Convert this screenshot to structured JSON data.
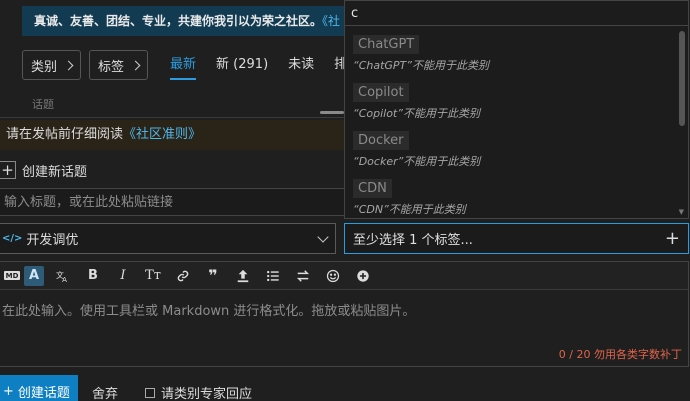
{
  "banner": {
    "text": "真诚、友善、团结、专业，共建你我引以为荣之社区。",
    "link": "《社"
  },
  "nav": {
    "category_label": "类别",
    "tags_label": "标签",
    "tabs": [
      {
        "label": "最新",
        "active": true
      },
      {
        "label": "新 (291)",
        "active": false
      },
      {
        "label": "未读",
        "active": false
      },
      {
        "label": "排",
        "active": false
      }
    ],
    "topic_column": "话题"
  },
  "composer": {
    "guideline_text": "请在发帖前仔细阅读",
    "guideline_link": "《社区准则》",
    "create_topic_label": "创建新话题",
    "title_placeholder": "输入标题，或在此处粘贴链接",
    "category_value": "开发调优",
    "tag_placeholder": "至少选择 1 个标签...",
    "editor_placeholder": "在此处输入。使用工具栏或 Markdown 进行格式化。拖放或粘贴图片。",
    "char_count": "0 / 20 勿用各类字数补丁",
    "submit_label": "创建话题",
    "discard_label": "舍弃",
    "expert_label": "请类别专家回应"
  },
  "toolbar": {
    "icons": [
      "markdown-toggle-icon",
      "font-style-icon",
      "translate-icon",
      "bold-icon",
      "italic-icon",
      "heading-icon",
      "link-icon",
      "quote-icon",
      "upload-icon",
      "bullet-list-icon",
      "swap-icon",
      "emoji-icon",
      "add-circle-icon"
    ],
    "labels": {
      "a": "A",
      "bold": "B",
      "italic": "I",
      "heading": "Tт",
      "quote": "❞"
    }
  },
  "tag_dropdown": {
    "search_value": "c",
    "items": [
      {
        "tag": "ChatGPT",
        "note": "“ChatGPT”不能用于此类别"
      },
      {
        "tag": "Copilot",
        "note": "“Copilot”不能用于此类别"
      },
      {
        "tag": "Docker",
        "note": "“Docker”不能用于此类别"
      },
      {
        "tag": "CDN",
        "note": "“CDN”不能用于此类别"
      }
    ]
  },
  "colors": {
    "accent": "#2b9ce0",
    "submit": "#0d7fc2",
    "warning": "#e0644a",
    "banner_bg": "#123b52",
    "background": "#1f1f1f"
  }
}
